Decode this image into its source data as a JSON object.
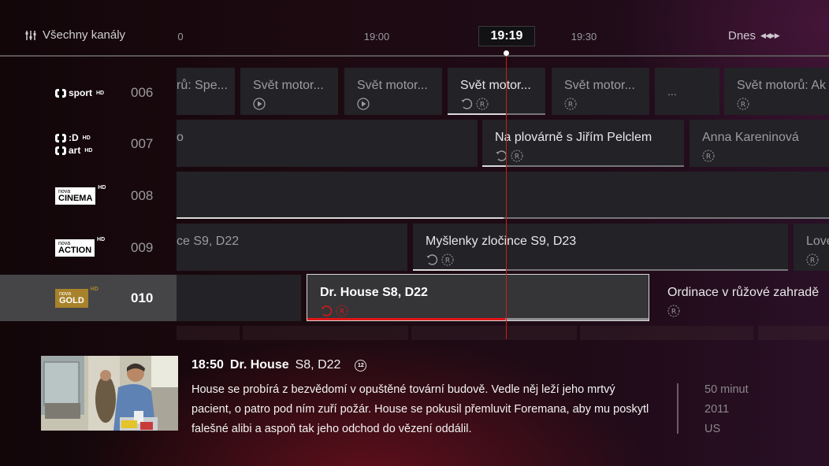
{
  "header": {
    "filter_label": "Všechny kanály",
    "filter_icon": "sliders-icon",
    "time_ticks": [
      "0",
      "19:00",
      "19:30"
    ],
    "current_time": "19:19",
    "day_label": "Dnes",
    "day_nav_icon": "prev-next-arrows-icon"
  },
  "channels": [
    {
      "number": "006",
      "logo": "ČT sport HD",
      "logo_text": "sport",
      "logo_hd": "HD"
    },
    {
      "number": "007",
      "logo": "ČT :D / ČT art HD",
      "logo_text_1": ":D",
      "logo_text_2": "art",
      "logo_hd": "HD"
    },
    {
      "number": "008",
      "logo": "Nova Cinema HD",
      "logo_small": "nova",
      "logo_big": "CINEMA",
      "logo_hd": "HD"
    },
    {
      "number": "009",
      "logo": "Nova Action HD",
      "logo_small": "nova",
      "logo_big": "ACTION",
      "logo_hd": "HD"
    },
    {
      "number": "010",
      "logo": "Nova Gold HD",
      "logo_small": "nova",
      "logo_big": "GOLD",
      "logo_hd": "HD",
      "selected": true
    }
  ],
  "programs": {
    "row006": [
      {
        "title": "rů: Spe...",
        "icons": []
      },
      {
        "title": "Svět motor...",
        "icons": [
          "play-icon"
        ]
      },
      {
        "title": "Svět motor...",
        "icons": [
          "play-icon"
        ]
      },
      {
        "title": "Svět motor...",
        "icons": [
          "replay-icon",
          "record-icon"
        ],
        "progress": 0.6
      },
      {
        "title": "Svět motor...",
        "icons": [
          "record-icon"
        ]
      },
      {
        "title": "...",
        "icons": []
      },
      {
        "title": "Svět motorů: Ak",
        "icons": [
          "record-icon"
        ]
      }
    ],
    "row007": [
      {
        "title": "o",
        "icons": []
      },
      {
        "title": "Na plovárně s Jiřím Pelclem",
        "icons": [
          "replay-icon",
          "record-icon"
        ],
        "progress": 0.12
      },
      {
        "title": "Anna Kareninová",
        "icons": [
          "record-icon"
        ]
      }
    ],
    "row008": [
      {
        "title": "",
        "icons": [],
        "progress": 0.5
      }
    ],
    "row009": [
      {
        "title": "ce S9, D22",
        "icons": []
      },
      {
        "title": "Myšlenky zločince S9, D23",
        "icons": [
          "replay-icon",
          "record-icon"
        ],
        "progress": 0.25
      },
      {
        "title": "Love",
        "icons": [
          "record-icon"
        ]
      }
    ],
    "row010": [
      {
        "title": "",
        "icons": []
      },
      {
        "title": "Dr. House S8, D22",
        "icons": [
          "replay-icon",
          "record-icon"
        ],
        "progress": 0.58,
        "selected": true
      },
      {
        "title": "Ordinace v růžové zahradě",
        "icons": [
          "record-icon"
        ]
      }
    ]
  },
  "details": {
    "start_time": "18:50",
    "title": "Dr. House",
    "episode": "S8, D22",
    "age_rating": "12",
    "description": "House se probírá z bezvědomí v opuštěné tovární budově. Vedle něj leží jeho mrtvý pacient, o patro pod ním zuří požár. House se pokusil přemluvit Foremana, aby mu poskytl falešné alibi a aspoň tak jeho odchod do vězení oddálil.",
    "duration": "50 minut",
    "year": "2011",
    "country": "US"
  },
  "colors": {
    "accent_red": "#e01818",
    "selected_border": "#d8d8d8",
    "gold_logo": "#a8822a"
  }
}
